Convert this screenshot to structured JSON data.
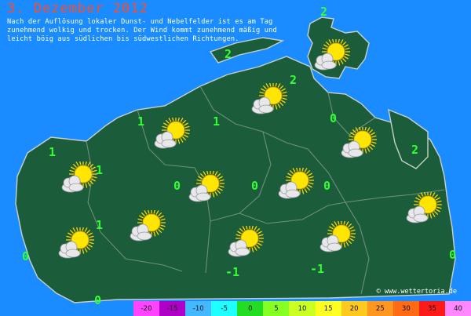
{
  "header": {
    "title": "3. Dezember 2012",
    "description": "Nach der Auflösung lokaler Dunst- und Nebelfelder ist es am Tag zunehmend wolkig und trocken. Der Wind kommt zunehmend mäßig und leicht böig aus südlichen bis südwestlichen Richtungen."
  },
  "copyright": "© www.wettertoria.de",
  "colors": {
    "sea": "#1a8cff",
    "land": "#1b5c3a",
    "title": "#ff4a2a",
    "text": "#ffffff",
    "temperature": "#33ff33"
  },
  "weather_symbol": "sun-behind-cloud-icon",
  "temperatures": [
    {
      "id": "north-ruegen",
      "value": "2"
    },
    {
      "id": "zingst",
      "value": "2"
    },
    {
      "id": "stralsund",
      "value": "2"
    },
    {
      "id": "greifswald-north",
      "value": "0"
    },
    {
      "id": "usedom",
      "value": "2"
    },
    {
      "id": "west-coast",
      "value": "1"
    },
    {
      "id": "wismar",
      "value": "1"
    },
    {
      "id": "rostock-south",
      "value": "1"
    },
    {
      "id": "schwerin-east",
      "value": "1"
    },
    {
      "id": "southwest",
      "value": "1"
    },
    {
      "id": "guestrow",
      "value": "0"
    },
    {
      "id": "teterow",
      "value": "0"
    },
    {
      "id": "demmin",
      "value": "0"
    },
    {
      "id": "parchim",
      "value": "0"
    },
    {
      "id": "far-south",
      "value": "0"
    },
    {
      "id": "mueritz",
      "value": "-1"
    },
    {
      "id": "neubrandenburg-south",
      "value": "-1"
    },
    {
      "id": "uecker",
      "value": "0"
    }
  ],
  "scale": [
    {
      "label": "-20",
      "color": "#ff44ff"
    },
    {
      "label": "-15",
      "color": "#b000c8"
    },
    {
      "label": "-10",
      "color": "#44b8ff"
    },
    {
      "label": "-5",
      "color": "#1fffff"
    },
    {
      "label": "0",
      "color": "#22dd22"
    },
    {
      "label": "5",
      "color": "#88ff22"
    },
    {
      "label": "10",
      "color": "#ccff22"
    },
    {
      "label": "15",
      "color": "#ffff22"
    },
    {
      "label": "20",
      "color": "#ffc81e"
    },
    {
      "label": "25",
      "color": "#ff9620"
    },
    {
      "label": "30",
      "color": "#ff6a14"
    },
    {
      "label": "35",
      "color": "#ff1a1a"
    },
    {
      "label": "40",
      "color": "#ff88ff"
    }
  ]
}
